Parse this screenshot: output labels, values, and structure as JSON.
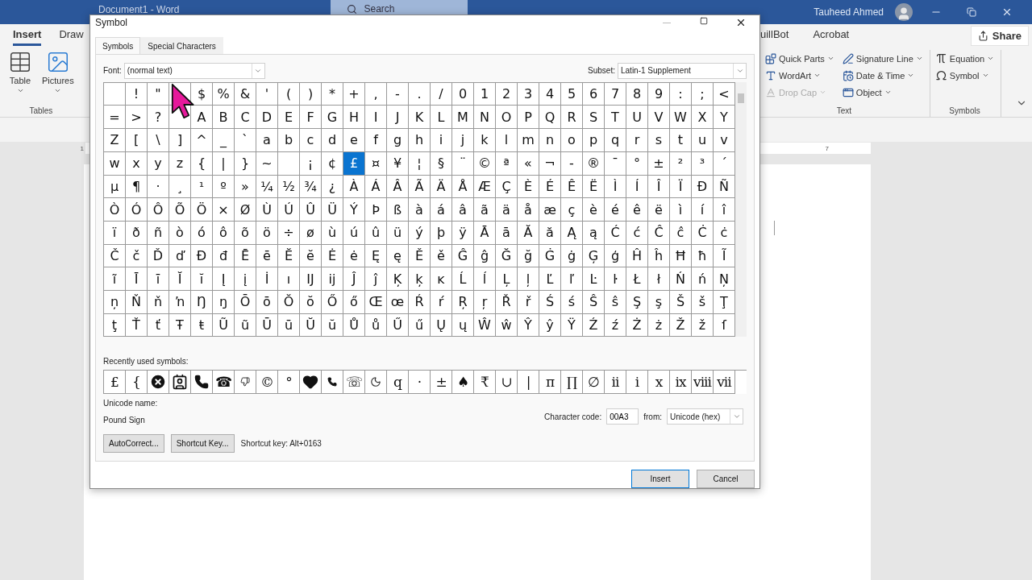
{
  "word": {
    "title": "Document1 - Word",
    "search": {
      "placeholder": "Search"
    },
    "user": "Tauheed Ahmed",
    "tabs": [
      {
        "label": "Insert",
        "selected": true
      },
      {
        "label": "Draw",
        "selected": false
      }
    ],
    "tabs_right": [
      {
        "label": "uillBot",
        "selected": false
      },
      {
        "label": "Acrobat",
        "selected": false
      }
    ],
    "share": "Share",
    "ribbon_left": {
      "items": [
        {
          "label": "Table"
        },
        {
          "label": "Pictures"
        }
      ],
      "group_label": "Tables"
    },
    "text_group": {
      "label": "Text",
      "items": [
        {
          "label": "Quick Parts",
          "disabled": false
        },
        {
          "label": "WordArt",
          "disabled": false
        },
        {
          "label": "Drop Cap",
          "disabled": true
        },
        {
          "label": "Signature Line",
          "disabled": false
        },
        {
          "label": "Date & Time",
          "disabled": false
        },
        {
          "label": "Object",
          "disabled": false
        }
      ]
    },
    "symbols_group": {
      "label": "Symbols",
      "items": [
        {
          "label": "Equation"
        },
        {
          "label": "Symbol"
        }
      ]
    },
    "ruler_mark": "7",
    "vertical_ruler_mark": "1"
  },
  "dialog": {
    "title": "Symbol",
    "tabs": [
      {
        "label": "Symbols",
        "selected": true
      },
      {
        "label": "Special Characters",
        "selected": false
      }
    ],
    "font": {
      "label": "Font:",
      "value": "(normal text)"
    },
    "subset": {
      "label": "Subset:",
      "value": "Latin-1 Supplement"
    },
    "grid": [
      {
        "cells": [
          {
            "selected": false
          },
          {
            "c": "!",
            "selected": false
          },
          {
            "c": "\"",
            "selected": false
          },
          {
            "selected": false
          },
          {
            "c": "$",
            "selected": false
          },
          {
            "c": "%",
            "selected": false
          },
          {
            "c": "&",
            "selected": false
          },
          {
            "c": "'",
            "selected": false
          },
          {
            "c": "(",
            "selected": false
          },
          {
            "c": ")",
            "selected": false
          },
          {
            "c": "*",
            "selected": false
          },
          {
            "c": "+",
            "selected": false
          },
          {
            "c": ",",
            "selected": false
          },
          {
            "c": "-",
            "selected": false
          },
          {
            "c": ".",
            "selected": false
          },
          {
            "c": "/",
            "selected": false
          },
          {
            "c": "0",
            "selected": false
          },
          {
            "c": "1",
            "selected": false
          },
          {
            "c": "2",
            "selected": false
          },
          {
            "c": "3",
            "selected": false
          },
          {
            "c": "4",
            "selected": false
          },
          {
            "c": "5",
            "selected": false
          },
          {
            "c": "6",
            "selected": false
          },
          {
            "c": "7",
            "selected": false
          },
          {
            "c": "8",
            "selected": false
          },
          {
            "c": "9",
            "selected": false
          },
          {
            "c": ":",
            "selected": false
          },
          {
            "c": ";",
            "selected": false
          },
          {
            "c": "<",
            "selected": false
          }
        ]
      },
      {
        "cells": [
          {
            "c": "=",
            "selected": false
          },
          {
            "c": ">",
            "selected": false
          },
          {
            "c": "?",
            "selected": false
          },
          {
            "selected": false
          },
          {
            "c": "A",
            "selected": false
          },
          {
            "c": "B",
            "selected": false
          },
          {
            "c": "C",
            "selected": false
          },
          {
            "c": "D",
            "selected": false
          },
          {
            "c": "E",
            "selected": false
          },
          {
            "c": "F",
            "selected": false
          },
          {
            "c": "G",
            "selected": false
          },
          {
            "c": "H",
            "selected": false
          },
          {
            "c": "I",
            "selected": false
          },
          {
            "c": "J",
            "selected": false
          },
          {
            "c": "K",
            "selected": false
          },
          {
            "c": "L",
            "selected": false
          },
          {
            "c": "M",
            "selected": false
          },
          {
            "c": "N",
            "selected": false
          },
          {
            "c": "O",
            "selected": false
          },
          {
            "c": "P",
            "selected": false
          },
          {
            "c": "Q",
            "selected": false
          },
          {
            "c": "R",
            "selected": false
          },
          {
            "c": "S",
            "selected": false
          },
          {
            "c": "T",
            "selected": false
          },
          {
            "c": "U",
            "selected": false
          },
          {
            "c": "V",
            "selected": false
          },
          {
            "c": "W",
            "selected": false
          },
          {
            "c": "X",
            "selected": false
          },
          {
            "c": "Y",
            "selected": false
          }
        ]
      },
      {
        "cells": [
          {
            "c": "Z",
            "selected": false
          },
          {
            "c": "[",
            "selected": false
          },
          {
            "c": "\\",
            "selected": false
          },
          {
            "c": "]",
            "selected": false
          },
          {
            "c": "^",
            "selected": false
          },
          {
            "c": "_",
            "selected": false
          },
          {
            "c": "`",
            "selected": false
          },
          {
            "c": "a",
            "selected": false
          },
          {
            "c": "b",
            "selected": false
          },
          {
            "c": "c",
            "selected": false
          },
          {
            "c": "d",
            "selected": false
          },
          {
            "c": "e",
            "selected": false
          },
          {
            "c": "f",
            "selected": false
          },
          {
            "c": "g",
            "selected": false
          },
          {
            "c": "h",
            "selected": false
          },
          {
            "c": "i",
            "selected": false
          },
          {
            "c": "j",
            "selected": false
          },
          {
            "c": "k",
            "selected": false
          },
          {
            "c": "l",
            "selected": false
          },
          {
            "c": "m",
            "selected": false
          },
          {
            "c": "n",
            "selected": false
          },
          {
            "c": "o",
            "selected": false
          },
          {
            "c": "p",
            "selected": false
          },
          {
            "c": "q",
            "selected": false
          },
          {
            "c": "r",
            "selected": false
          },
          {
            "c": "s",
            "selected": false
          },
          {
            "c": "t",
            "selected": false
          },
          {
            "c": "u",
            "selected": false
          },
          {
            "c": "v",
            "selected": false
          }
        ]
      },
      {
        "cells": [
          {
            "c": "w",
            "selected": false
          },
          {
            "c": "x",
            "selected": false
          },
          {
            "c": "y",
            "selected": false
          },
          {
            "c": "z",
            "selected": false
          },
          {
            "c": "{",
            "selected": false
          },
          {
            "c": "|",
            "selected": false
          },
          {
            "c": "}",
            "selected": false
          },
          {
            "c": "~",
            "selected": false
          },
          {
            "selected": false
          },
          {
            "c": "¡",
            "selected": false
          },
          {
            "c": "¢",
            "selected": false
          },
          {
            "c": "£",
            "selected": true
          },
          {
            "c": "¤",
            "selected": false
          },
          {
            "c": "¥",
            "selected": false
          },
          {
            "c": "¦",
            "selected": false
          },
          {
            "c": "§",
            "selected": false
          },
          {
            "c": "¨",
            "selected": false
          },
          {
            "c": "©",
            "selected": false
          },
          {
            "c": "ª",
            "selected": false
          },
          {
            "c": "«",
            "selected": false
          },
          {
            "c": "¬",
            "selected": false
          },
          {
            "c": "-",
            "selected": false
          },
          {
            "c": "®",
            "selected": false
          },
          {
            "c": "¯",
            "selected": false
          },
          {
            "c": "°",
            "selected": false
          },
          {
            "c": "±",
            "selected": false
          },
          {
            "c": "²",
            "selected": false
          },
          {
            "c": "³",
            "selected": false
          },
          {
            "c": "´",
            "selected": false
          }
        ]
      },
      {
        "cells": [
          {
            "c": "µ",
            "selected": false
          },
          {
            "c": "¶",
            "selected": false
          },
          {
            "c": "·",
            "selected": false
          },
          {
            "c": "¸",
            "selected": false
          },
          {
            "c": "¹",
            "selected": false
          },
          {
            "c": "º",
            "selected": false
          },
          {
            "c": "»",
            "selected": false
          },
          {
            "c": "¼",
            "selected": false
          },
          {
            "c": "½",
            "selected": false
          },
          {
            "c": "¾",
            "selected": false
          },
          {
            "c": "¿",
            "selected": false
          },
          {
            "c": "À",
            "selected": false
          },
          {
            "c": "Á",
            "selected": false
          },
          {
            "c": "Â",
            "selected": false
          },
          {
            "c": "Ã",
            "selected": false
          },
          {
            "c": "Ä",
            "selected": false
          },
          {
            "c": "Å",
            "selected": false
          },
          {
            "c": "Æ",
            "selected": false
          },
          {
            "c": "Ç",
            "selected": false
          },
          {
            "c": "È",
            "selected": false
          },
          {
            "c": "É",
            "selected": false
          },
          {
            "c": "Ê",
            "selected": false
          },
          {
            "c": "Ë",
            "selected": false
          },
          {
            "c": "Ì",
            "selected": false
          },
          {
            "c": "Í",
            "selected": false
          },
          {
            "c": "Î",
            "selected": false
          },
          {
            "c": "Ï",
            "selected": false
          },
          {
            "c": "Ð",
            "selected": false
          },
          {
            "c": "Ñ",
            "selected": false
          }
        ]
      },
      {
        "cells": [
          {
            "c": "Ò",
            "selected": false
          },
          {
            "c": "Ó",
            "selected": false
          },
          {
            "c": "Ô",
            "selected": false
          },
          {
            "c": "Õ",
            "selected": false
          },
          {
            "c": "Ö",
            "selected": false
          },
          {
            "c": "×",
            "selected": false
          },
          {
            "c": "Ø",
            "selected": false
          },
          {
            "c": "Ù",
            "selected": false
          },
          {
            "c": "Ú",
            "selected": false
          },
          {
            "c": "Û",
            "selected": false
          },
          {
            "c": "Ü",
            "selected": false
          },
          {
            "c": "Ý",
            "selected": false
          },
          {
            "c": "Þ",
            "selected": false
          },
          {
            "c": "ß",
            "selected": false
          },
          {
            "c": "à",
            "selected": false
          },
          {
            "c": "á",
            "selected": false
          },
          {
            "c": "â",
            "selected": false
          },
          {
            "c": "ã",
            "selected": false
          },
          {
            "c": "ä",
            "selected": false
          },
          {
            "c": "å",
            "selected": false
          },
          {
            "c": "æ",
            "selected": false
          },
          {
            "c": "ç",
            "selected": false
          },
          {
            "c": "è",
            "selected": false
          },
          {
            "c": "é",
            "selected": false
          },
          {
            "c": "ê",
            "selected": false
          },
          {
            "c": "ë",
            "selected": false
          },
          {
            "c": "ì",
            "selected": false
          },
          {
            "c": "í",
            "selected": false
          },
          {
            "c": "î",
            "selected": false
          }
        ]
      },
      {
        "cells": [
          {
            "c": "ï",
            "selected": false
          },
          {
            "c": "ð",
            "selected": false
          },
          {
            "c": "ñ",
            "selected": false
          },
          {
            "c": "ò",
            "selected": false
          },
          {
            "c": "ó",
            "selected": false
          },
          {
            "c": "ô",
            "selected": false
          },
          {
            "c": "õ",
            "selected": false
          },
          {
            "c": "ö",
            "selected": false
          },
          {
            "c": "÷",
            "selected": false
          },
          {
            "c": "ø",
            "selected": false
          },
          {
            "c": "ù",
            "selected": false
          },
          {
            "c": "ú",
            "selected": false
          },
          {
            "c": "û",
            "selected": false
          },
          {
            "c": "ü",
            "selected": false
          },
          {
            "c": "ý",
            "selected": false
          },
          {
            "c": "þ",
            "selected": false
          },
          {
            "c": "ÿ",
            "selected": false
          },
          {
            "c": "Ā",
            "selected": false
          },
          {
            "c": "ā",
            "selected": false
          },
          {
            "c": "Ă",
            "selected": false
          },
          {
            "c": "ă",
            "selected": false
          },
          {
            "c": "Ą",
            "selected": false
          },
          {
            "c": "ą",
            "selected": false
          },
          {
            "c": "Ć",
            "selected": false
          },
          {
            "c": "ć",
            "selected": false
          },
          {
            "c": "Ĉ",
            "selected": false
          },
          {
            "c": "ĉ",
            "selected": false
          },
          {
            "c": "Ċ",
            "selected": false
          },
          {
            "c": "ċ",
            "selected": false
          }
        ]
      },
      {
        "cells": [
          {
            "c": "Č",
            "selected": false
          },
          {
            "c": "č",
            "selected": false
          },
          {
            "c": "Ď",
            "selected": false
          },
          {
            "c": "ď",
            "selected": false
          },
          {
            "c": "Đ",
            "selected": false
          },
          {
            "c": "đ",
            "selected": false
          },
          {
            "c": "Ē",
            "selected": false
          },
          {
            "c": "ē",
            "selected": false
          },
          {
            "c": "Ĕ",
            "selected": false
          },
          {
            "c": "ĕ",
            "selected": false
          },
          {
            "c": "Ė",
            "selected": false
          },
          {
            "c": "ė",
            "selected": false
          },
          {
            "c": "Ę",
            "selected": false
          },
          {
            "c": "ę",
            "selected": false
          },
          {
            "c": "Ě",
            "selected": false
          },
          {
            "c": "ě",
            "selected": false
          },
          {
            "c": "Ĝ",
            "selected": false
          },
          {
            "c": "ĝ",
            "selected": false
          },
          {
            "c": "Ğ",
            "selected": false
          },
          {
            "c": "ğ",
            "selected": false
          },
          {
            "c": "Ġ",
            "selected": false
          },
          {
            "c": "ġ",
            "selected": false
          },
          {
            "c": "Ģ",
            "selected": false
          },
          {
            "c": "ģ",
            "selected": false
          },
          {
            "c": "Ĥ",
            "selected": false
          },
          {
            "c": "ĥ",
            "selected": false
          },
          {
            "c": "Ħ",
            "selected": false
          },
          {
            "c": "ħ",
            "selected": false
          },
          {
            "c": "Ĩ",
            "selected": false
          }
        ]
      },
      {
        "cells": [
          {
            "c": "ĩ",
            "selected": false
          },
          {
            "c": "Ī",
            "selected": false
          },
          {
            "c": "ī",
            "selected": false
          },
          {
            "c": "Ĭ",
            "selected": false
          },
          {
            "c": "ĭ",
            "selected": false
          },
          {
            "c": "Į",
            "selected": false
          },
          {
            "c": "į",
            "selected": false
          },
          {
            "c": "İ",
            "selected": false
          },
          {
            "c": "ı",
            "selected": false
          },
          {
            "c": "Ĳ",
            "selected": false
          },
          {
            "c": "ĳ",
            "selected": false
          },
          {
            "c": "Ĵ",
            "selected": false
          },
          {
            "c": "ĵ",
            "selected": false
          },
          {
            "c": "Ķ",
            "selected": false
          },
          {
            "c": "ķ",
            "selected": false
          },
          {
            "c": "ĸ",
            "selected": false
          },
          {
            "c": "Ĺ",
            "selected": false
          },
          {
            "c": "ĺ",
            "selected": false
          },
          {
            "c": "Ļ",
            "selected": false
          },
          {
            "c": "ļ",
            "selected": false
          },
          {
            "c": "Ľ",
            "selected": false
          },
          {
            "c": "ľ",
            "selected": false
          },
          {
            "c": "Ŀ",
            "selected": false
          },
          {
            "c": "ŀ",
            "selected": false
          },
          {
            "c": "Ł",
            "selected": false
          },
          {
            "c": "ł",
            "selected": false
          },
          {
            "c": "Ń",
            "selected": false
          },
          {
            "c": "ń",
            "selected": false
          },
          {
            "c": "Ņ",
            "selected": false
          }
        ]
      },
      {
        "cells": [
          {
            "c": "ņ",
            "selected": false
          },
          {
            "c": "Ň",
            "selected": false
          },
          {
            "c": "ň",
            "selected": false
          },
          {
            "c": "ŉ",
            "selected": false
          },
          {
            "c": "Ŋ",
            "selected": false
          },
          {
            "c": "ŋ",
            "selected": false
          },
          {
            "c": "Ō",
            "selected": false
          },
          {
            "c": "ō",
            "selected": false
          },
          {
            "c": "Ŏ",
            "selected": false
          },
          {
            "c": "ŏ",
            "selected": false
          },
          {
            "c": "Ő",
            "selected": false
          },
          {
            "c": "ő",
            "selected": false
          },
          {
            "c": "Œ",
            "selected": false
          },
          {
            "c": "œ",
            "selected": false
          },
          {
            "c": "Ŕ",
            "selected": false
          },
          {
            "c": "ŕ",
            "selected": false
          },
          {
            "c": "Ŗ",
            "selected": false
          },
          {
            "c": "ŗ",
            "selected": false
          },
          {
            "c": "Ř",
            "selected": false
          },
          {
            "c": "ř",
            "selected": false
          },
          {
            "c": "Ś",
            "selected": false
          },
          {
            "c": "ś",
            "selected": false
          },
          {
            "c": "Ŝ",
            "selected": false
          },
          {
            "c": "ŝ",
            "selected": false
          },
          {
            "c": "Ş",
            "selected": false
          },
          {
            "c": "ş",
            "selected": false
          },
          {
            "c": "Š",
            "selected": false
          },
          {
            "c": "š",
            "selected": false
          },
          {
            "c": "Ţ",
            "selected": false
          }
        ]
      },
      {
        "cells": [
          {
            "c": "ţ",
            "selected": false
          },
          {
            "c": "Ť",
            "selected": false
          },
          {
            "c": "ť",
            "selected": false
          },
          {
            "c": "Ŧ",
            "selected": false
          },
          {
            "c": "ŧ",
            "selected": false
          },
          {
            "c": "Ũ",
            "selected": false
          },
          {
            "c": "ũ",
            "selected": false
          },
          {
            "c": "Ū",
            "selected": false
          },
          {
            "c": "ū",
            "selected": false
          },
          {
            "c": "Ŭ",
            "selected": false
          },
          {
            "c": "ŭ",
            "selected": false
          },
          {
            "c": "Ů",
            "selected": false
          },
          {
            "c": "ů",
            "selected": false
          },
          {
            "c": "Ű",
            "selected": false
          },
          {
            "c": "ű",
            "selected": false
          },
          {
            "c": "Ų",
            "selected": false
          },
          {
            "c": "ų",
            "selected": false
          },
          {
            "c": "Ŵ",
            "selected": false
          },
          {
            "c": "ŵ",
            "selected": false
          },
          {
            "c": "Ŷ",
            "selected": false
          },
          {
            "c": "ŷ",
            "selected": false
          },
          {
            "c": "Ÿ",
            "selected": false
          },
          {
            "c": "Ź",
            "selected": false
          },
          {
            "c": "ź",
            "selected": false
          },
          {
            "c": "Ż",
            "selected": false
          },
          {
            "c": "ż",
            "selected": false
          },
          {
            "c": "Ž",
            "selected": false
          },
          {
            "c": "ž",
            "selected": false
          },
          {
            "c": "ſ",
            "selected": false
          }
        ]
      }
    ],
    "recent_label": "Recently used symbols:",
    "recent": [
      {
        "kind": "char",
        "char": "£"
      },
      {
        "kind": "char",
        "char": "{"
      },
      {
        "kind": "icon"
      },
      {
        "kind": "icon"
      },
      {
        "kind": "icon"
      },
      {
        "kind": "char",
        "char": "☎"
      },
      {
        "kind": "icon"
      },
      {
        "kind": "char",
        "char": "©"
      },
      {
        "kind": "char",
        "char": "°"
      },
      {
        "kind": "icon"
      },
      {
        "kind": "icon"
      },
      {
        "kind": "char",
        "char": "☏"
      },
      {
        "kind": "icon"
      },
      {
        "kind": "char",
        "char": "q"
      },
      {
        "kind": "char",
        "char": "·"
      },
      {
        "kind": "char",
        "char": "±"
      },
      {
        "kind": "char",
        "char": "♠"
      },
      {
        "kind": "char",
        "char": "₹"
      },
      {
        "kind": "char",
        "char": "∪"
      },
      {
        "kind": "char",
        "char": "|"
      },
      {
        "kind": "char",
        "char": "π"
      },
      {
        "kind": "char",
        "char": "∏"
      },
      {
        "kind": "char",
        "char": "∅"
      },
      {
        "kind": "char",
        "char": "ii"
      },
      {
        "kind": "char",
        "char": "i"
      },
      {
        "kind": "char",
        "char": "x"
      },
      {
        "kind": "char",
        "char": "ix"
      },
      {
        "kind": "char",
        "char": "viii"
      },
      {
        "kind": "char",
        "char": "vii"
      }
    ],
    "unicode_name_label": "Unicode name:",
    "unicode_name": "Pound Sign",
    "character_code": {
      "label": "Character code:",
      "value": "00A3"
    },
    "from": {
      "label": "from:",
      "value": "Unicode (hex)"
    },
    "buttons": [
      "AutoCorrect...",
      "Shortcut Key..."
    ],
    "shortcut_text": "Shortcut key: Alt+0163",
    "actions": [
      "Insert",
      "Cancel"
    ]
  }
}
